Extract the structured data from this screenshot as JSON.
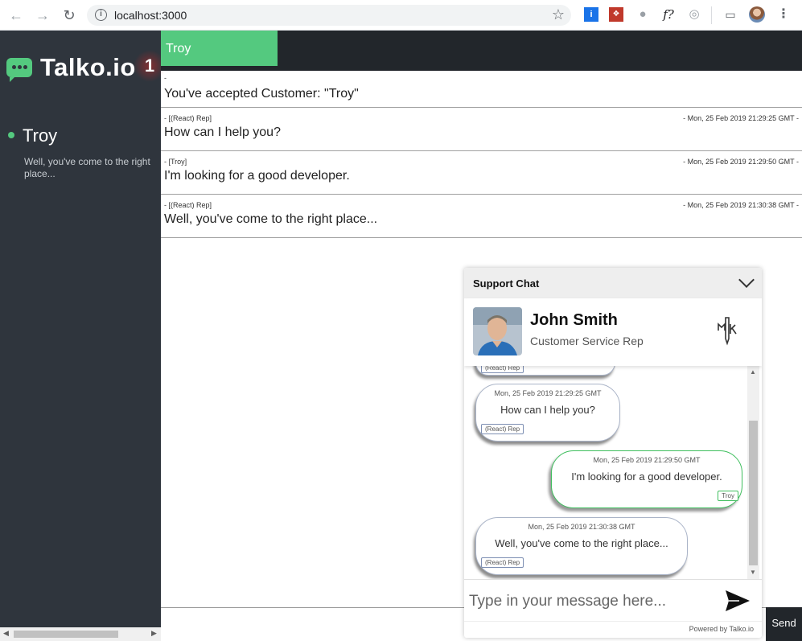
{
  "browser": {
    "url": "localhost:3000",
    "icons": [
      "back-icon",
      "forward-icon",
      "reload-icon",
      "info-icon",
      "star-icon",
      "cast-icon",
      "profile-icon",
      "menu-icon"
    ]
  },
  "sidebar": {
    "logo_text": "Talko.io",
    "badge": "1",
    "contacts": [
      {
        "name": "Troy",
        "preview": "Well, you've come to the right place..."
      }
    ]
  },
  "main": {
    "active_tab": "Troy",
    "messages": [
      {
        "sender": "-",
        "time": "",
        "text": "You've accepted Customer: \"Troy\""
      },
      {
        "sender": "- [(React) Rep]",
        "time": "- Mon, 25 Feb 2019 21:29:25 GMT -",
        "text": "How can I help you?"
      },
      {
        "sender": "- [Troy]",
        "time": "- Mon, 25 Feb 2019 21:29:50 GMT -",
        "text": "I'm looking for a good developer."
      },
      {
        "sender": "- [(React) Rep]",
        "time": "- Mon, 25 Feb 2019 21:30:38 GMT -",
        "text": "Well, you've come to the right place..."
      }
    ],
    "send_label": "Send"
  },
  "widget": {
    "title": "Support Chat",
    "agent_name": "John Smith",
    "agent_role": "Customer Service Rep",
    "partial_sender": "(React) Rep",
    "bubbles": [
      {
        "time": "Mon, 25 Feb 2019 21:29:25 GMT",
        "text": "How can I help you?",
        "sender": "(React) Rep"
      },
      {
        "time": "Mon, 25 Feb 2019 21:29:50 GMT",
        "text": "I'm looking for a good developer.",
        "sender": "Troy"
      },
      {
        "time": "Mon, 25 Feb 2019 21:30:38 GMT",
        "text": "Well, you've come to the right place...",
        "sender": "(React) Rep"
      }
    ],
    "input_placeholder": "Type in your message here...",
    "powered_by": "Powered by Talko.io"
  },
  "colors": {
    "accent_green": "#54c97f",
    "sidebar_bg": "#2f353d",
    "topbar_bg": "#22262b"
  }
}
